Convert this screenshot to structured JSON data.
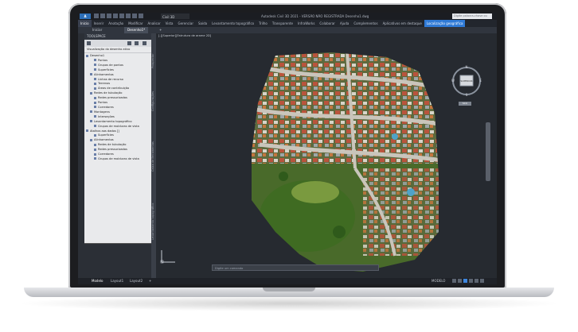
{
  "window": {
    "app_button": "A",
    "workspace": "Civil 3D",
    "title": "Autodesk Civil 3D 2021 - VERSÃO NÃO REGISTRADA  Desenho1.dwg",
    "search_placeholder": "Digite palavra-chave ou frase"
  },
  "ribbon": {
    "tabs": [
      "Início",
      "Inserir",
      "Anotação",
      "Modificar",
      "Analisar",
      "Vista",
      "Gerenciar",
      "Saída",
      "Levantamento topográfico",
      "Trilho",
      "Transparente",
      "InfraWorks",
      "Colaborar",
      "Ajuda",
      "Complementos",
      "Aplicativos em destaque",
      "Localização geográfica"
    ]
  },
  "document_tabs": {
    "start": "Iniciar",
    "drawing": "Desenho1*",
    "add": "+"
  },
  "toolspace": {
    "header": "TOOLSPACE",
    "view_label": "Visualização do desenho ativo",
    "side_tabs": [
      "Prospector",
      "Configurações",
      "Caixa de ferramentas",
      "Levantamento topográfico"
    ],
    "tree": [
      {
        "label": "Desenho1",
        "level": 0
      },
      {
        "label": "Pontos",
        "level": 2
      },
      {
        "label": "Grupos de pontos",
        "level": 2
      },
      {
        "label": "Superfícies",
        "level": 2
      },
      {
        "label": "Alinhamentos",
        "level": 1
      },
      {
        "label": "Linhas de recurso",
        "level": 2
      },
      {
        "label": "Terrenos",
        "level": 2
      },
      {
        "label": "Áreas de contribuição",
        "level": 2
      },
      {
        "label": "Redes de tubulação",
        "level": 1
      },
      {
        "label": "Redes pressurizadas",
        "level": 2
      },
      {
        "label": "Pontos",
        "level": 2
      },
      {
        "label": "Corredores",
        "level": 2
      },
      {
        "label": "Montagens",
        "level": 1
      },
      {
        "label": "Interseções",
        "level": 2
      },
      {
        "label": "Levantamento topográfico",
        "level": 1
      },
      {
        "label": "Grupos de molduras de vista",
        "level": 2
      },
      {
        "label": "Atalhos aos dados []",
        "level": 0
      },
      {
        "label": "Superfícies",
        "level": 2
      },
      {
        "label": "Alinhamentos",
        "level": 1
      },
      {
        "label": "Redes de tubulação",
        "level": 2
      },
      {
        "label": "Redes pressurizadas",
        "level": 2
      },
      {
        "label": "Corredores",
        "level": 2
      },
      {
        "label": "Grupos de molduras de vista",
        "level": 2
      }
    ]
  },
  "viewport": {
    "label": "[-][Superior][Estrutura de arame 2D]",
    "viewcube": {
      "north": "N",
      "south": "S",
      "east": "E",
      "west": "W",
      "face": "SUPERIOR",
      "wcs": "SCU"
    },
    "command_placeholder": "Digite um comando"
  },
  "statusbar": {
    "tabs": [
      "Modelo",
      "Layout1",
      "Layout2",
      "+"
    ],
    "mode": "MODELO"
  },
  "colors": {
    "accent": "#2f7ad6",
    "background": "#262a30"
  }
}
